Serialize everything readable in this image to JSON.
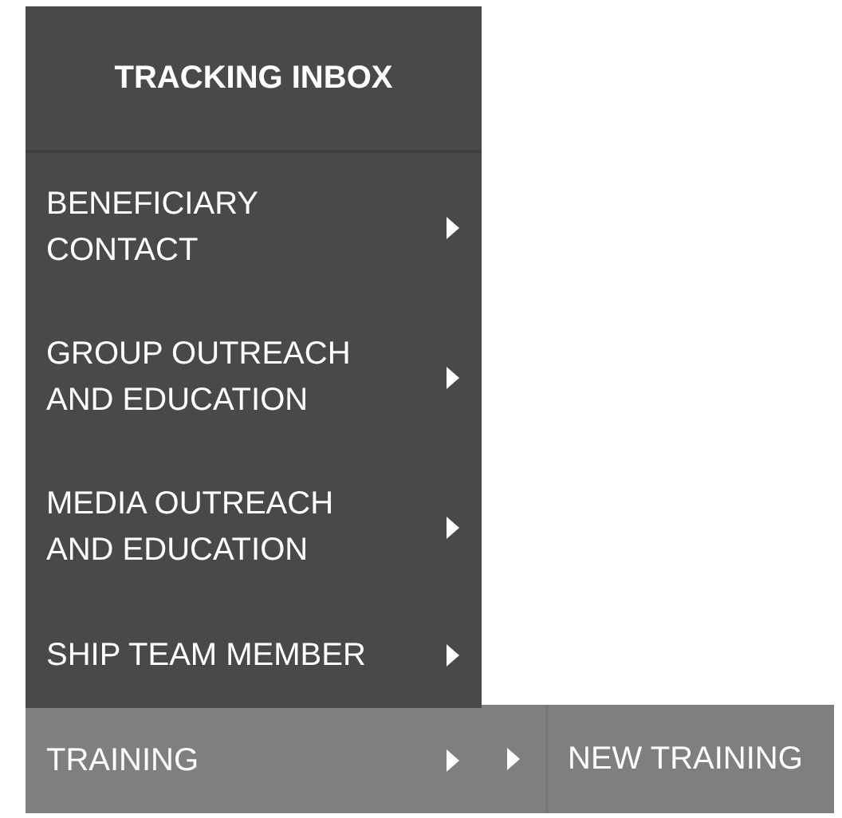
{
  "menu": {
    "title": "TRACKING INBOX",
    "items": [
      {
        "label": "BENEFICIARY\nCONTACT",
        "selected": false,
        "has_submenu": true
      },
      {
        "label": "GROUP OUTREACH\nAND EDUCATION",
        "selected": false,
        "has_submenu": true
      },
      {
        "label": "MEDIA OUTREACH\nAND EDUCATION",
        "selected": false,
        "has_submenu": true
      },
      {
        "label": "SHIP TEAM MEMBER",
        "selected": false,
        "has_submenu": true
      },
      {
        "label": "TRAINING",
        "selected": true,
        "has_submenu": true,
        "submenu": [
          {
            "label": "NEW TRAINING",
            "selected": false
          }
        ]
      }
    ]
  }
}
